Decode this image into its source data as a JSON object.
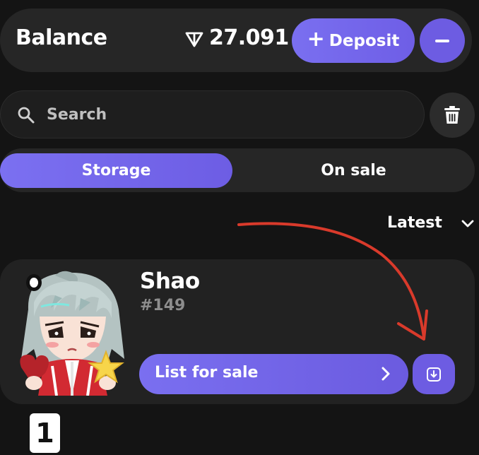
{
  "balance": {
    "title": "Balance",
    "currency_icon": "ton-icon",
    "amount": "27.091",
    "deposit_label": "Deposit",
    "deposit_icon": "plus-icon",
    "withdraw_icon": "minus-icon"
  },
  "search": {
    "placeholder": "Search",
    "value": "",
    "icon": "search-icon",
    "clear_icon": "trash-icon"
  },
  "tabs": [
    {
      "label": "Storage",
      "active": true
    },
    {
      "label": "On sale",
      "active": false
    }
  ],
  "sort": {
    "selected": "Latest",
    "icon": "chevron-down-icon"
  },
  "items": [
    {
      "name": "Shao",
      "number": "#149",
      "action_label": "List for sale",
      "action_icon": "chevron-right-icon",
      "secondary_icon": "withdraw-icon"
    }
  ],
  "annotation": {
    "step": "1",
    "arrow_color": "#d93a2b"
  },
  "colors": {
    "accent": "#7066ea",
    "background": "#141414",
    "surface": "#262626",
    "muted_text": "#8d8d8d"
  }
}
